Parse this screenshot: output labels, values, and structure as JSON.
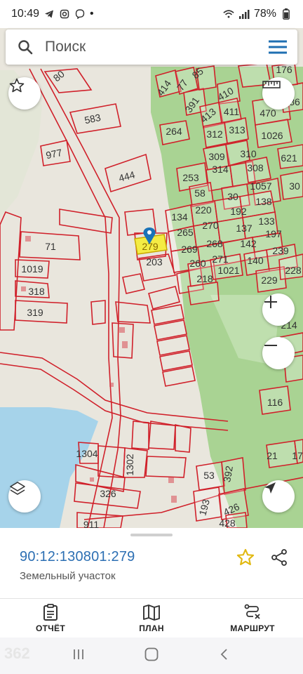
{
  "status_bar": {
    "time": "10:49",
    "battery": "78%",
    "dot": "•"
  },
  "search": {
    "placeholder": "Поиск"
  },
  "map": {
    "selected_parcel_label": "279",
    "parcel_labels": [
      "80",
      "85",
      "176",
      "414",
      "77",
      "391",
      "410",
      "583",
      "413",
      "411",
      "470",
      "86",
      "264",
      "312",
      "313",
      "1026",
      "977",
      "309",
      "310",
      "621",
      "444",
      "314",
      "308",
      "253",
      "30",
      "1057",
      "58",
      "30",
      "134",
      "220",
      "192",
      "138",
      "265",
      "270",
      "137",
      "133",
      "269",
      "268",
      "142",
      "197",
      "203",
      "260",
      "271",
      "140",
      "239",
      "71",
      "218",
      "1021",
      "229",
      "228",
      "1019",
      "318",
      "319",
      "214",
      "116",
      "21",
      "17",
      "1304",
      "1302",
      "53",
      "392",
      "326",
      "193",
      "426",
      "428",
      "911"
    ]
  },
  "details": {
    "cadastral_number": "90:12:130801:279",
    "object_type": "Земельный участок"
  },
  "bottom_nav": {
    "report": "ОТЧЁТ",
    "plan": "ПЛАН",
    "route": "МАРШРУТ"
  },
  "watermark": "362",
  "colors": {
    "parcel_outline": "#d0202a",
    "forest": "#a9d393",
    "water": "#a6d3ea",
    "accent": "#2c6fb3",
    "selected_fill": "#f4ec44",
    "star": "#e1b80f"
  }
}
